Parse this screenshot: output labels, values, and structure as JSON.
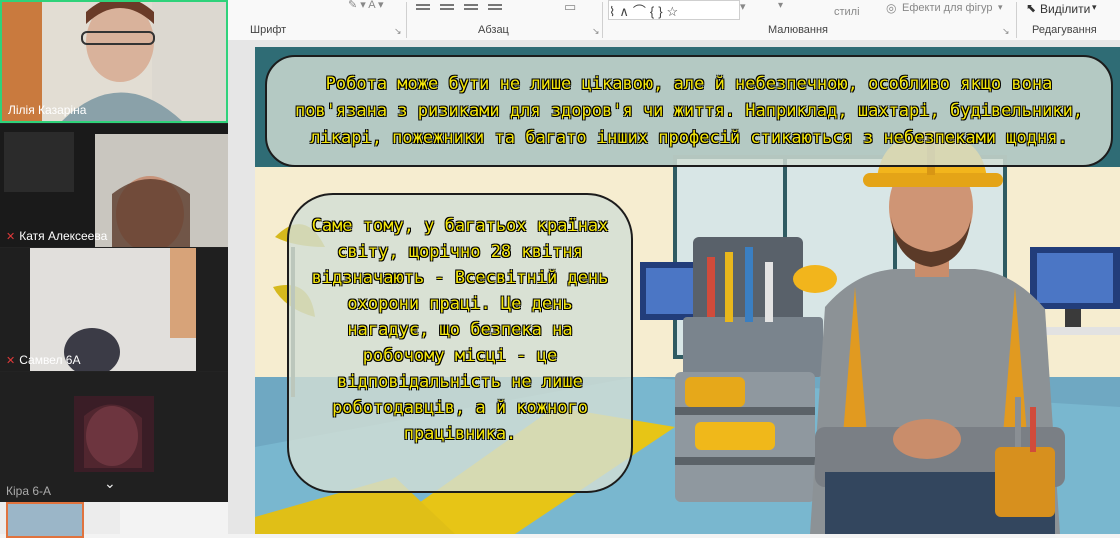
{
  "ribbon": {
    "groups": {
      "font": "Шрифт",
      "paragraph": "Абзац",
      "drawing": "Малювання",
      "editing": "Редагування"
    },
    "quick_styles_partial": "стилі",
    "shape_effects": "Ефекти для фігур",
    "select": "Виділити"
  },
  "participants": [
    {
      "name": "Лілія Казаріна",
      "muted": false,
      "active": true
    },
    {
      "name": "Катя Алексеева",
      "muted": true,
      "active": false
    },
    {
      "name": "Самвел 6А",
      "muted": true,
      "active": false
    },
    {
      "name": "Кіра 6-А",
      "muted": false,
      "active": false
    }
  ],
  "slide": {
    "top_text": "Робота може бути не лише цікавою, але й небезпечною, особливо якщо вона пов'язана з ризиками для здоров'я чи життя. Наприклад, шахтарі, будівельники, лікарі, пожежники та багато інших професій стикаються з небезпеками щодня.",
    "left_text": "Саме тому, у багатьох країнах світу, щорічно 28 квітня відзначають - Всесвітній день охорони праці. Це день нагадує, що безпека на робочому місці - це відповідальність не лише роботодавців, а й кожного працівника."
  },
  "colors": {
    "bubble_text": "#f4e60a",
    "helmet": "#f2b51c",
    "active_speaker": "#2fd27a"
  }
}
